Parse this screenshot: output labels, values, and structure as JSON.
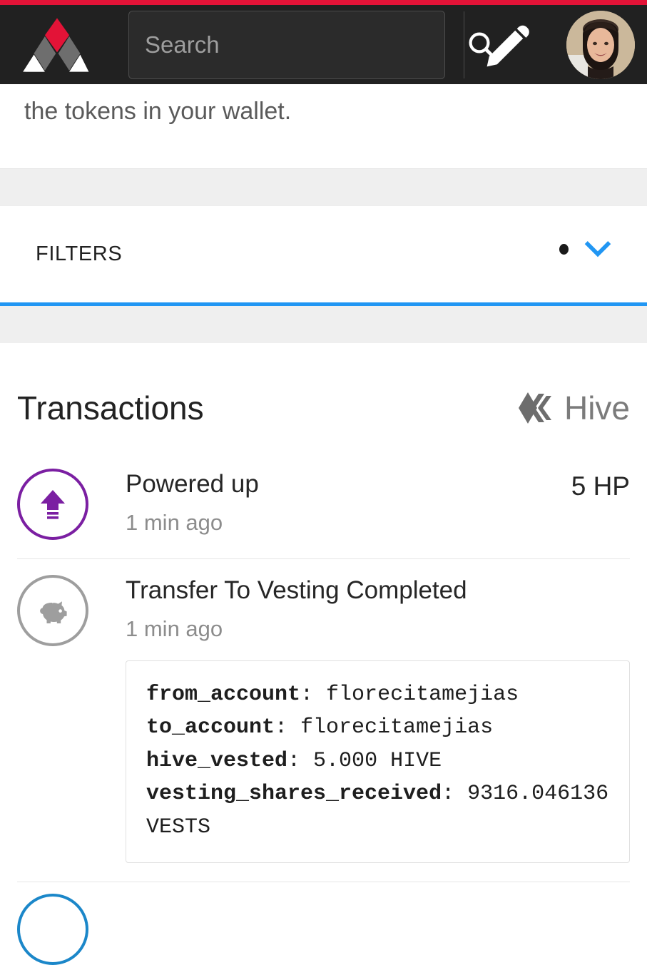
{
  "header": {
    "logo_icon": "aurora-a-logo",
    "accent_red": "#e31337",
    "background": "#212121",
    "search": {
      "placeholder": "Search",
      "value": "",
      "icon": "search-icon"
    },
    "compose_icon": "pencil-icon",
    "avatar_icon": "user-avatar"
  },
  "intro": {
    "text": "the tokens in your wallet."
  },
  "filters": {
    "label": "FILTERS",
    "indicator_dot": "•",
    "expand_icon": "chevron-down-icon",
    "accent_color": "#2196f3"
  },
  "transactions": {
    "title": "Transactions",
    "brand_label": "Hive",
    "brand_icon": "hive-logo",
    "items": [
      {
        "icon": "power-up-arrow-icon",
        "icon_color": "#7b1fa2",
        "name": "Powered up",
        "time": "1 min ago",
        "amount": "5 HP",
        "details": []
      },
      {
        "icon": "piggy-bank-icon",
        "icon_color": "#9e9e9e",
        "name": "Transfer To Vesting Completed",
        "time": "1 min ago",
        "amount": "",
        "details": [
          {
            "key": "from_account",
            "value": "florecitamejias"
          },
          {
            "key": "to_account",
            "value": "florecitamejias"
          },
          {
            "key": "hive_vested",
            "value": "5.000 HIVE"
          },
          {
            "key": "vesting_shares_received",
            "value": "9316.046136 VESTS"
          }
        ]
      }
    ]
  }
}
